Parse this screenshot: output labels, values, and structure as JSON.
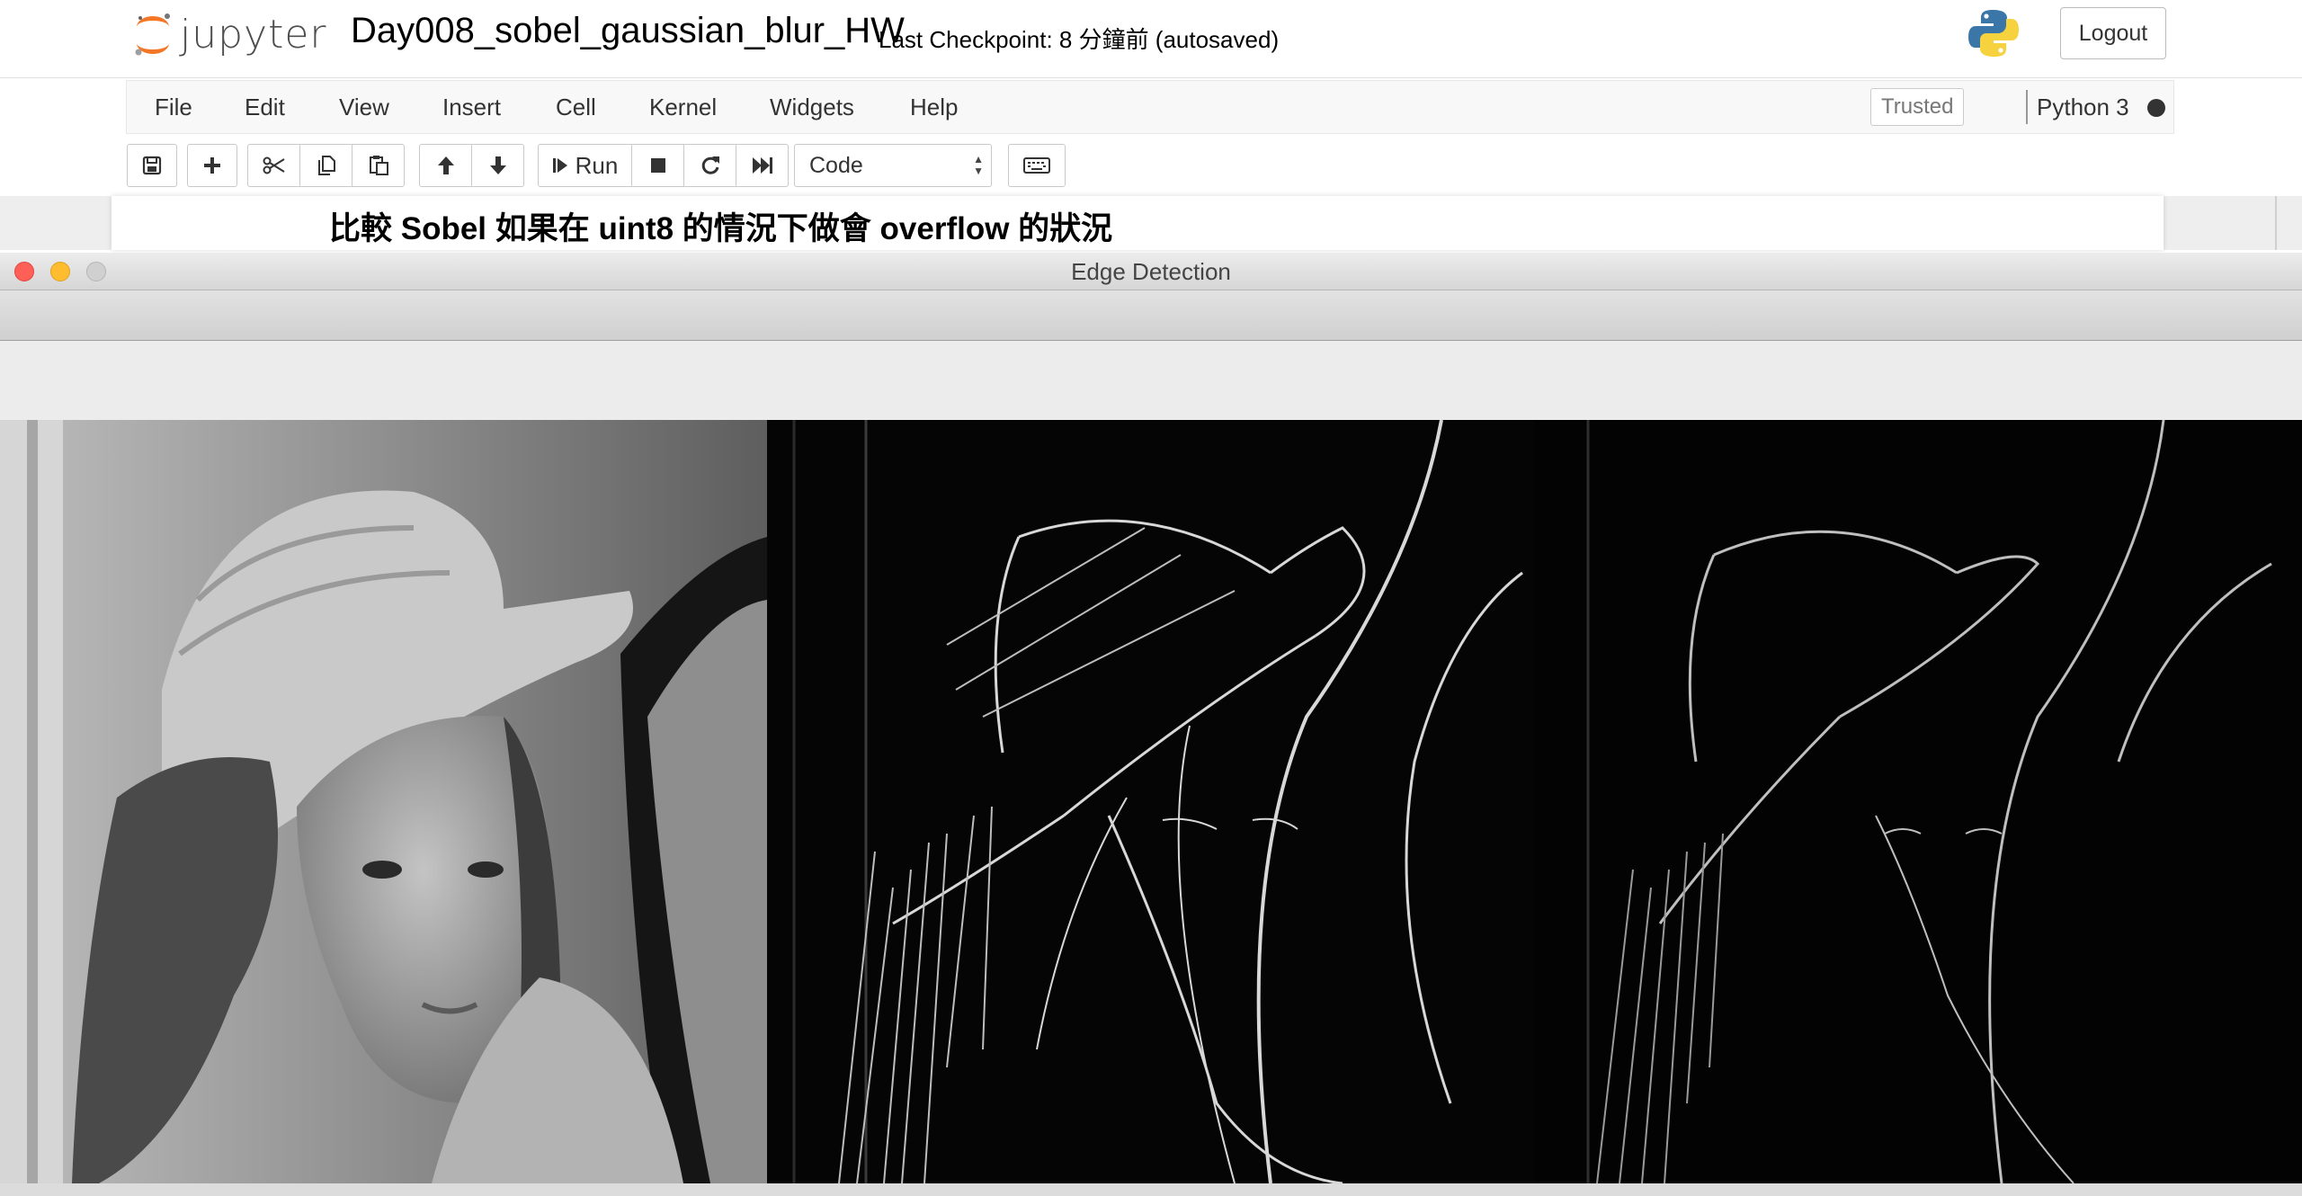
{
  "header": {
    "logo_text": "jupyter",
    "notebook_name": "Day008_sobel_gaussian_blur_HW",
    "checkpoint": "Last Checkpoint: 8 分鐘前   (autosaved)",
    "logout_label": "Logout"
  },
  "menubar": {
    "items": [
      "File",
      "Edit",
      "View",
      "Insert",
      "Cell",
      "Kernel",
      "Widgets",
      "Help"
    ],
    "trusted": "Trusted",
    "kernel": "Python 3"
  },
  "toolbar": {
    "run_label": "Run",
    "cell_type": "Code",
    "icons": [
      "save-icon",
      "plus-icon",
      "cut-icon",
      "copy-icon",
      "paste-icon",
      "arrow-up-icon",
      "arrow-down-icon",
      "run-icon",
      "stop-icon",
      "restart-icon",
      "fast-forward-icon",
      "keyboard-icon"
    ]
  },
  "notebook": {
    "heading": "比較 Sobel 如果在 uint8 的情況下做會 overflow 的狀況"
  },
  "window": {
    "title": "Edge Detection",
    "panels": [
      "grayscale-original",
      "sobel-edges-int16",
      "sobel-edges-uint8"
    ]
  },
  "colors": {
    "jupyter_orange": "#f37726",
    "traffic_red": "#fe5f57",
    "traffic_yellow": "#febc2e",
    "traffic_gray": "#d0d0d0"
  }
}
